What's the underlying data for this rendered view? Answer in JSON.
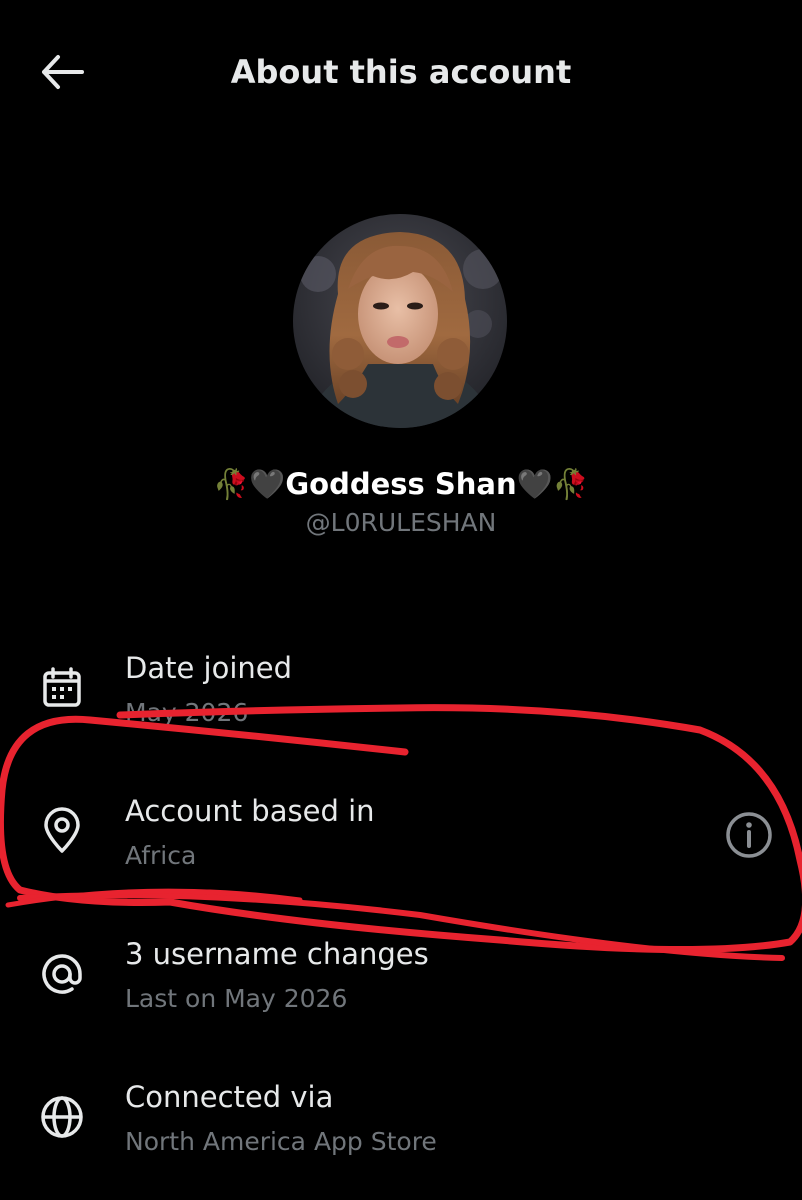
{
  "header": {
    "title": "About this account",
    "back_icon": "arrow-left-icon"
  },
  "profile": {
    "display_name": "🥀🖤Goddess Shan🖤🥀",
    "handle": "@L0RULESHAN",
    "avatar": "profile-photo"
  },
  "details": [
    {
      "icon": "calendar-icon",
      "title": "Date joined",
      "subtitle": "May 2026"
    },
    {
      "icon": "location-pin-icon",
      "title": "Account based in",
      "subtitle": "Africa",
      "info_icon": "info-icon"
    },
    {
      "icon": "at-sign-icon",
      "title": "3 username changes",
      "subtitle": "Last on May 2026"
    },
    {
      "icon": "globe-icon",
      "title": "Connected via",
      "subtitle": "North America App Store"
    }
  ],
  "annotation": {
    "color": "#e8232f",
    "shape": "hand-drawn-circle"
  }
}
